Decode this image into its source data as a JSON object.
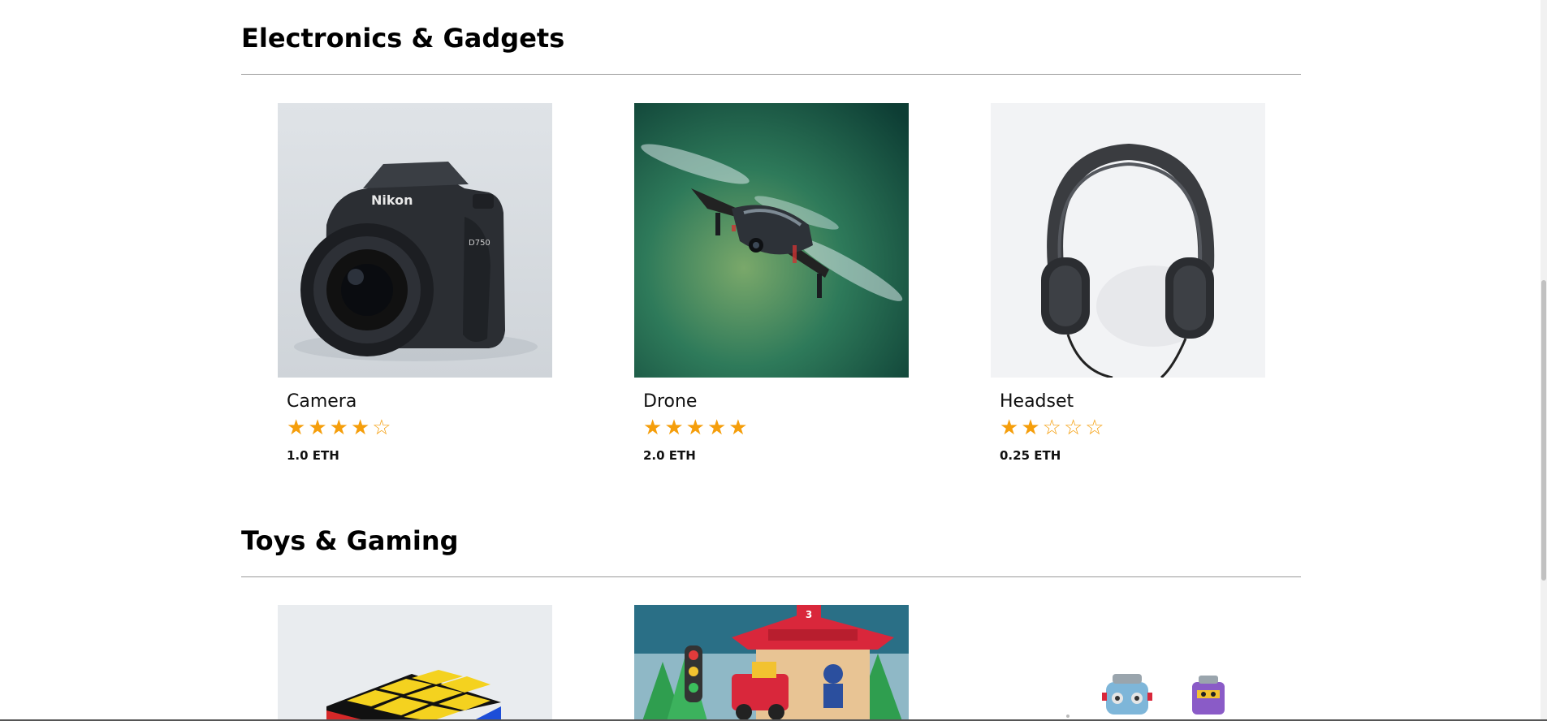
{
  "sections": [
    {
      "title": "Electronics & Gadgets",
      "products": [
        {
          "name": "Camera",
          "rating": 4,
          "price": "1.0 ETH",
          "image_icon": "camera-image"
        },
        {
          "name": "Drone",
          "rating": 5,
          "price": "2.0 ETH",
          "image_icon": "drone-image"
        },
        {
          "name": "Headset",
          "rating": 2,
          "price": "0.25 ETH",
          "image_icon": "headset-image"
        }
      ]
    },
    {
      "title": "Toys & Gaming",
      "products": [
        {
          "image_icon": "rubiks-cube-image"
        },
        {
          "image_icon": "toy-train-station-image"
        },
        {
          "image_icon": "toy-robots-image"
        }
      ]
    }
  ],
  "colors": {
    "star": "#f59e0b",
    "rule": "#9a9a9a"
  }
}
